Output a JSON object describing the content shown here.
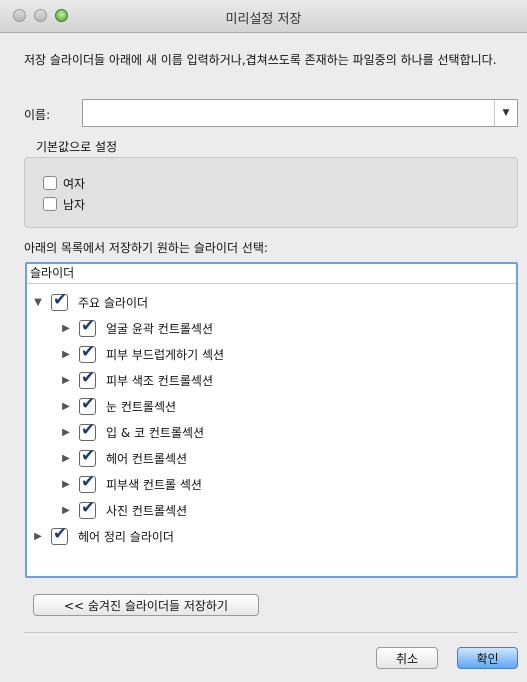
{
  "window": {
    "title": "미리설정 저장"
  },
  "description": "저장 슬라이더들 아래에 새 이름 입력하거나,겹쳐쓰도록 존재하는 파일중의 하나를 선택합니다.",
  "name_field": {
    "label": "이름:",
    "value": "",
    "arrow": "▼"
  },
  "defaults": {
    "title": "기본값으로 설정",
    "options": [
      {
        "label": "여자",
        "checked": false
      },
      {
        "label": "남자",
        "checked": false
      }
    ]
  },
  "tree": {
    "prompt": "아래의 목록에서 저장하기 원하는 슬라이더 선택:",
    "header": "슬라이더",
    "items": [
      {
        "label": "주요 슬라이더",
        "expanded": true,
        "checked": true,
        "children": [
          {
            "label": "얼굴 윤곽 컨트롤섹션",
            "checked": true
          },
          {
            "label": "피부 부드럽게하기 섹션",
            "checked": true
          },
          {
            "label": "피부 색조 컨트롤섹션",
            "checked": true
          },
          {
            "label": "눈 컨트롤섹션",
            "checked": true
          },
          {
            "label": "입 & 코 컨트롤섹션",
            "checked": true
          },
          {
            "label": "헤어 컨트롤섹션",
            "checked": true
          },
          {
            "label": "피부색 컨트롤 섹션",
            "checked": true
          },
          {
            "label": "사진 컨트롤섹션",
            "checked": true
          }
        ]
      },
      {
        "label": "헤어 정리 슬라이더",
        "expanded": false,
        "checked": true
      }
    ]
  },
  "buttons": {
    "save_hidden": "<< 숨겨진 슬라이더들 저장하기",
    "cancel": "취소",
    "ok": "확인"
  },
  "icons": {
    "expanded": "▼",
    "collapsed": "▶"
  }
}
